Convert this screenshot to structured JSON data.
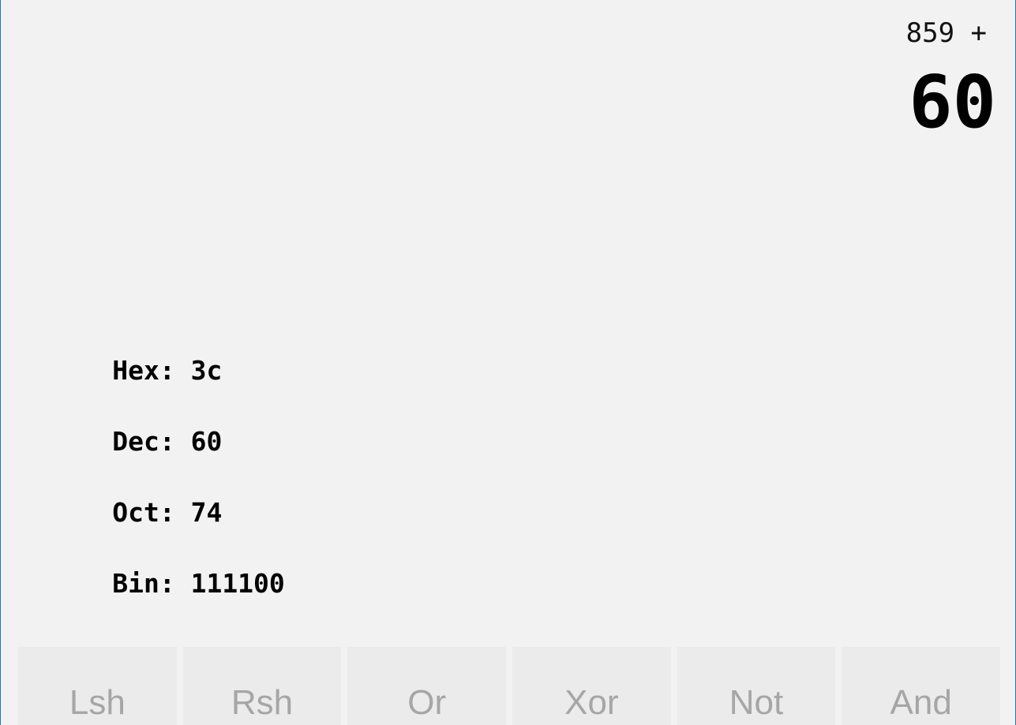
{
  "display": {
    "expression": "859 +",
    "result": "60"
  },
  "bases": [
    {
      "label": "Hex:",
      "value": "3c"
    },
    {
      "label": "Dec:",
      "value": "60"
    },
    {
      "label": "Oct:",
      "value": "74"
    },
    {
      "label": "Bin:",
      "value": "111100"
    }
  ],
  "operators": [
    {
      "label": "Lsh"
    },
    {
      "label": "Rsh"
    },
    {
      "label": "Or"
    },
    {
      "label": "Xor"
    },
    {
      "label": "Not"
    },
    {
      "label": "And"
    }
  ],
  "colors": {
    "window_border": "#1a73c7",
    "background": "#f2f2f2",
    "button_background": "#ebebeb",
    "button_text_disabled": "#a6a6a6"
  }
}
